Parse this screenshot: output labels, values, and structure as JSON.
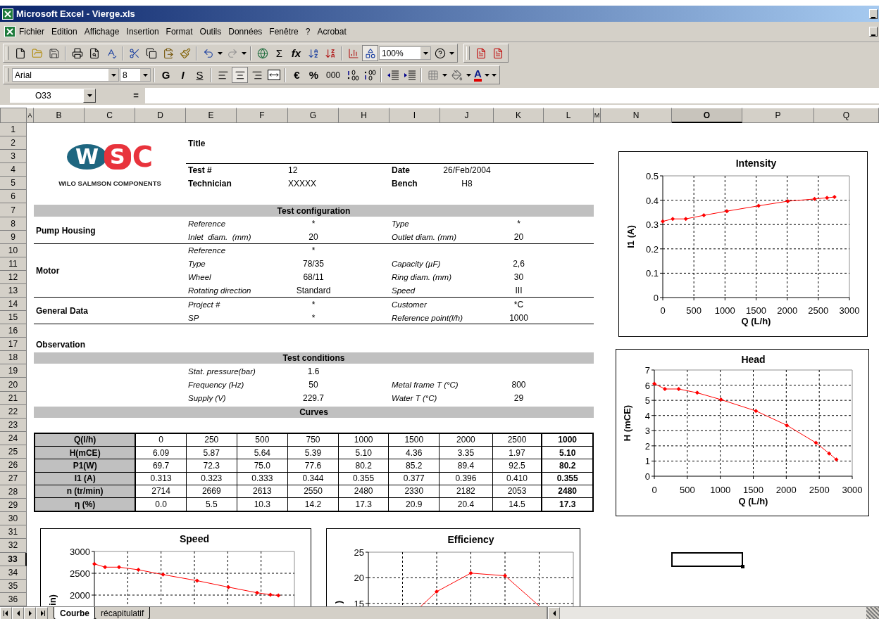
{
  "window": {
    "title": "Microsoft Excel - Vierge.xls"
  },
  "menu": [
    "Fichier",
    "Edition",
    "Affichage",
    "Insertion",
    "Format",
    "Outils",
    "Données",
    "Fenêtre",
    "?",
    "Acrobat"
  ],
  "standard_toolbar": {
    "sum": "Σ",
    "function": "fx",
    "zoom": "100%"
  },
  "formatting_toolbar": {
    "font": "Arial",
    "size": "8",
    "bold": "G",
    "italic": "I",
    "underline": "S",
    "alignments": [
      {
        "selected": false
      },
      {
        "selected": true
      },
      {
        "selected": false
      }
    ],
    "currency": "€",
    "percent": "%",
    "thousands": "000",
    "font_color": "A"
  },
  "formula_bar": {
    "cell": "O33",
    "equals": "="
  },
  "columns": [
    {
      "label": "A",
      "selected": false
    },
    {
      "label": "B",
      "selected": false
    },
    {
      "label": "C",
      "selected": false
    },
    {
      "label": "D",
      "selected": false
    },
    {
      "label": "E",
      "selected": false
    },
    {
      "label": "F",
      "selected": false
    },
    {
      "label": "G",
      "selected": false
    },
    {
      "label": "H",
      "selected": false
    },
    {
      "label": "I",
      "selected": false
    },
    {
      "label": "J",
      "selected": false
    },
    {
      "label": "K",
      "selected": false
    },
    {
      "label": "L",
      "selected": false
    },
    {
      "label": "M",
      "selected": false
    },
    {
      "label": "N",
      "selected": false
    },
    {
      "label": "O",
      "selected": true
    },
    {
      "label": "P",
      "selected": false
    },
    {
      "label": "Q",
      "selected": false
    }
  ],
  "rows": [
    {
      "label": "1",
      "selected": false
    },
    {
      "label": "2",
      "selected": false
    },
    {
      "label": "3",
      "selected": false
    },
    {
      "label": "4",
      "selected": false
    },
    {
      "label": "5",
      "selected": false
    },
    {
      "label": "6",
      "selected": false
    },
    {
      "label": "7",
      "selected": false
    },
    {
      "label": "8",
      "selected": false
    },
    {
      "label": "9",
      "selected": false
    },
    {
      "label": "10",
      "selected": false
    },
    {
      "label": "11",
      "selected": false
    },
    {
      "label": "12",
      "selected": false
    },
    {
      "label": "13",
      "selected": false
    },
    {
      "label": "14",
      "selected": false
    },
    {
      "label": "15",
      "selected": false
    },
    {
      "label": "16",
      "selected": false
    },
    {
      "label": "17",
      "selected": false
    },
    {
      "label": "18",
      "selected": false
    },
    {
      "label": "19",
      "selected": false
    },
    {
      "label": "20",
      "selected": false
    },
    {
      "label": "21",
      "selected": false
    },
    {
      "label": "22",
      "selected": false
    },
    {
      "label": "23",
      "selected": false
    },
    {
      "label": "24",
      "selected": false
    },
    {
      "label": "25",
      "selected": false
    },
    {
      "label": "26",
      "selected": false
    },
    {
      "label": "27",
      "selected": false
    },
    {
      "label": "28",
      "selected": false
    },
    {
      "label": "29",
      "selected": false
    },
    {
      "label": "30",
      "selected": false
    },
    {
      "label": "31",
      "selected": false
    },
    {
      "label": "32",
      "selected": false
    },
    {
      "label": "33",
      "selected": true
    },
    {
      "label": "34",
      "selected": false
    },
    {
      "label": "35",
      "selected": false
    },
    {
      "label": "36",
      "selected": false
    }
  ],
  "report": {
    "logo": {
      "marks": [
        "W",
        "SC"
      ],
      "caption": "WILO SALMSON COMPONENTS"
    },
    "title": "Title",
    "header": [
      {
        "label": "Test #",
        "value": "12",
        "label_2": "Date",
        "value_2": "26/Feb/2004"
      },
      {
        "label": "Technician",
        "value": "XXXXX",
        "label_2": "Bench",
        "value_2": "H8"
      }
    ],
    "configuration": {
      "heading": "Test configuration",
      "groups": [
        {
          "name": "Pump Housing",
          "rows": [
            {
              "label": "Reference",
              "value": "*",
              "label_2": "Type",
              "value_2": "*"
            },
            {
              "label": "Inlet  diam.  (mm)",
              "value": "20",
              "label_2": "Outlet diam. (mm)",
              "value_2": "20"
            }
          ]
        },
        {
          "name": "Motor",
          "rows": [
            {
              "label": "Reference",
              "value": "*"
            },
            {
              "label": "Type",
              "value": "78/35",
              "label_2": "Capacity (µF)",
              "value_2": "2,6"
            },
            {
              "label": "Wheel",
              "value": "68/11",
              "label_2": "Ring diam. (mm)",
              "value_2": "30"
            },
            {
              "label": "Rotating direction",
              "value": "Standard",
              "label_2": "Speed",
              "value_2": "III"
            }
          ]
        },
        {
          "name": "General Data",
          "rows": [
            {
              "label": "Project #",
              "value": "*",
              "label_2": "Customer",
              "value_2": "*C"
            },
            {
              "label": "SP",
              "value": "*",
              "label_2": "Reference point(l/h)",
              "value_2": "1000"
            }
          ]
        }
      ]
    },
    "observation": "Observation",
    "conditions": {
      "heading": "Test conditions",
      "rows": [
        {
          "label": "Stat. pressure(bar)",
          "value": "1.6"
        },
        {
          "label": "Frequency (Hz)",
          "value": "50",
          "label_2": "Metal frame T (°C)",
          "value_2": "800"
        },
        {
          "label": "Supply (V)",
          "value": "229.7",
          "label_2": "Water T (°C)",
          "value_2": "29"
        }
      ]
    },
    "curves": {
      "heading": "Curves",
      "rows": [
        {
          "label": "Q(l/h)",
          "values": [
            "0",
            "250",
            "500",
            "750",
            "1000",
            "1500",
            "2000",
            "2500"
          ],
          "reference": "1000"
        },
        {
          "label": "H(mCE)",
          "values": [
            "6.09",
            "5.87",
            "5.64",
            "5.39",
            "5.10",
            "4.36",
            "3.35",
            "1.97"
          ],
          "reference": "5.10"
        },
        {
          "label": "P1(W)",
          "values": [
            "69.7",
            "72.3",
            "75.0",
            "77.6",
            "80.2",
            "85.2",
            "89.4",
            "92.5"
          ],
          "reference": "80.2"
        },
        {
          "label": "I1 (A)",
          "values": [
            "0.313",
            "0.323",
            "0.333",
            "0.344",
            "0.355",
            "0.377",
            "0.396",
            "0.410"
          ],
          "reference": "0.355"
        },
        {
          "label": "n (tr/min)",
          "values": [
            "2714",
            "2669",
            "2613",
            "2550",
            "2480",
            "2330",
            "2182",
            "2053"
          ],
          "reference": "2480"
        },
        {
          "label": "η  (%)",
          "values": [
            "0.0",
            "5.5",
            "10.3",
            "14.2",
            "17.3",
            "20.9",
            "20.4",
            "14.5"
          ],
          "reference": "17.3"
        }
      ]
    }
  },
  "charts": [
    {
      "kind": "data",
      "chart_data": {
        "type": "line",
        "title": "Intensity",
        "xlabel": "Q (L/h)",
        "ylabel": "I1 (A)",
        "grid": true,
        "x": [
          0,
          160,
          370,
          660,
          1030,
          1540,
          2010,
          2440,
          2640,
          2760
        ],
        "series": [
          {
            "color": "#ff0000",
            "marker": "diamond",
            "values": [
              0.313,
              0.323,
              0.323,
              0.338,
              0.355,
              0.377,
              0.396,
              0.405,
              0.41,
              0.413
            ]
          }
        ],
        "xlim": [
          0,
          3000
        ],
        "ylim": [
          0,
          0.5
        ],
        "xticks": [
          0,
          500,
          1000,
          1500,
          2000,
          2500,
          3000
        ],
        "yticks": [
          0,
          0.1,
          0.2,
          0.3,
          0.4,
          0.5
        ]
      }
    },
    {
      "kind": "data",
      "chart_data": {
        "type": "line",
        "title": "Head",
        "xlabel": "Q (L/h)",
        "ylabel": "H (mCE)",
        "grid": true,
        "x": [
          0,
          160,
          370,
          650,
          1010,
          1540,
          2010,
          2450,
          2650,
          2760
        ],
        "series": [
          {
            "color": "#ff0000",
            "marker": "diamond",
            "values": [
              6.1,
              5.75,
              5.75,
              5.5,
              5.05,
              4.3,
              3.35,
              2.2,
              1.5,
              1.1
            ]
          }
        ],
        "xlim": [
          0,
          3000
        ],
        "ylim": [
          0,
          7
        ],
        "xticks": [
          0,
          500,
          1000,
          1500,
          2000,
          2500,
          3000
        ],
        "yticks": [
          0,
          1,
          2,
          3,
          4,
          5,
          6,
          7
        ]
      }
    },
    {
      "kind": "sketch",
      "title": "Speed",
      "ylabel": "in)",
      "y_tick_labels": [
        "3000",
        "2500",
        "2000"
      ]
    },
    {
      "kind": "sketch",
      "title": "Efficiency",
      "ylabel": ")",
      "y_tick_labels": [
        "25",
        "20",
        "15"
      ]
    }
  ],
  "sheet_tabs": [
    {
      "label": "Courbe",
      "selected": true
    },
    {
      "label": "récapitulatif",
      "selected": false
    }
  ]
}
